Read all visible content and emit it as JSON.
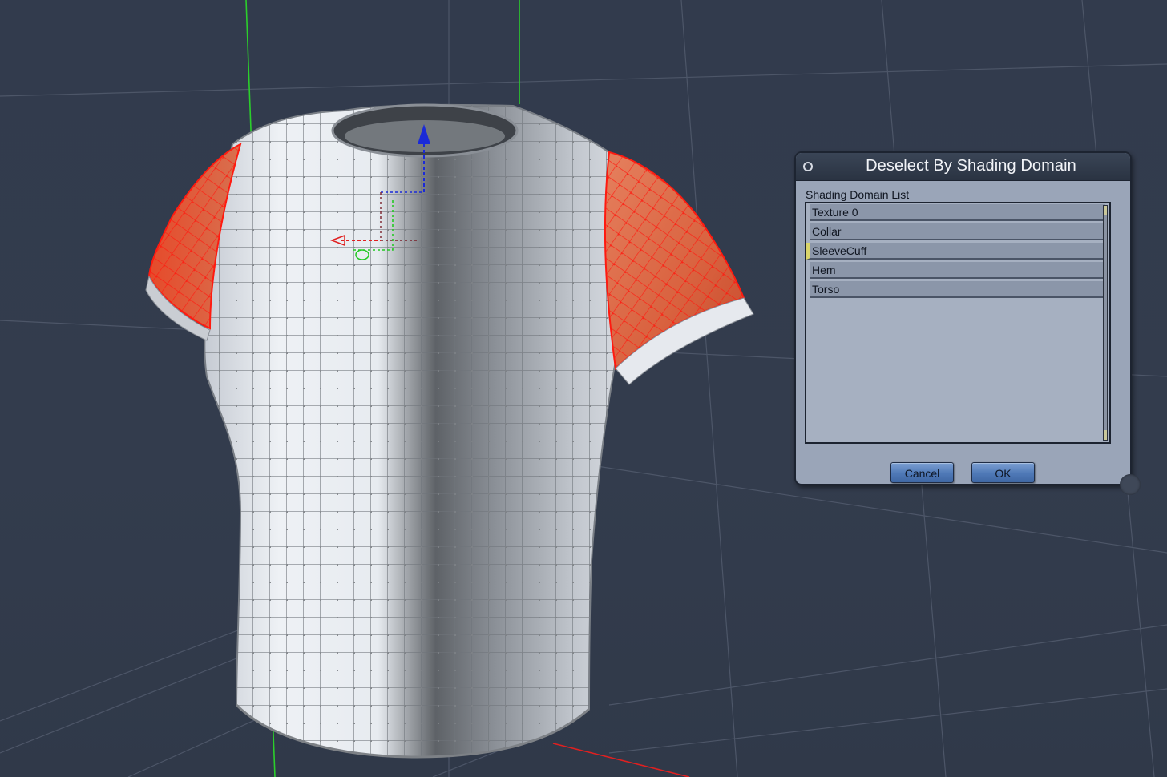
{
  "dialog": {
    "title": "Deselect By Shading Domain",
    "list_label": "Shading Domain List",
    "items": [
      {
        "label": "Texture 0",
        "selected": false
      },
      {
        "label": "Collar",
        "selected": false
      },
      {
        "label": "SleeveCuff",
        "selected": true
      },
      {
        "label": "Hem",
        "selected": false
      },
      {
        "label": "Torso",
        "selected": false
      }
    ],
    "cancel_label": "Cancel",
    "ok_label": "OK"
  },
  "viewport": {
    "background_color": "#323b4c",
    "selection_color": "#ff1a10",
    "mesh_color": "#e8ecf2"
  }
}
